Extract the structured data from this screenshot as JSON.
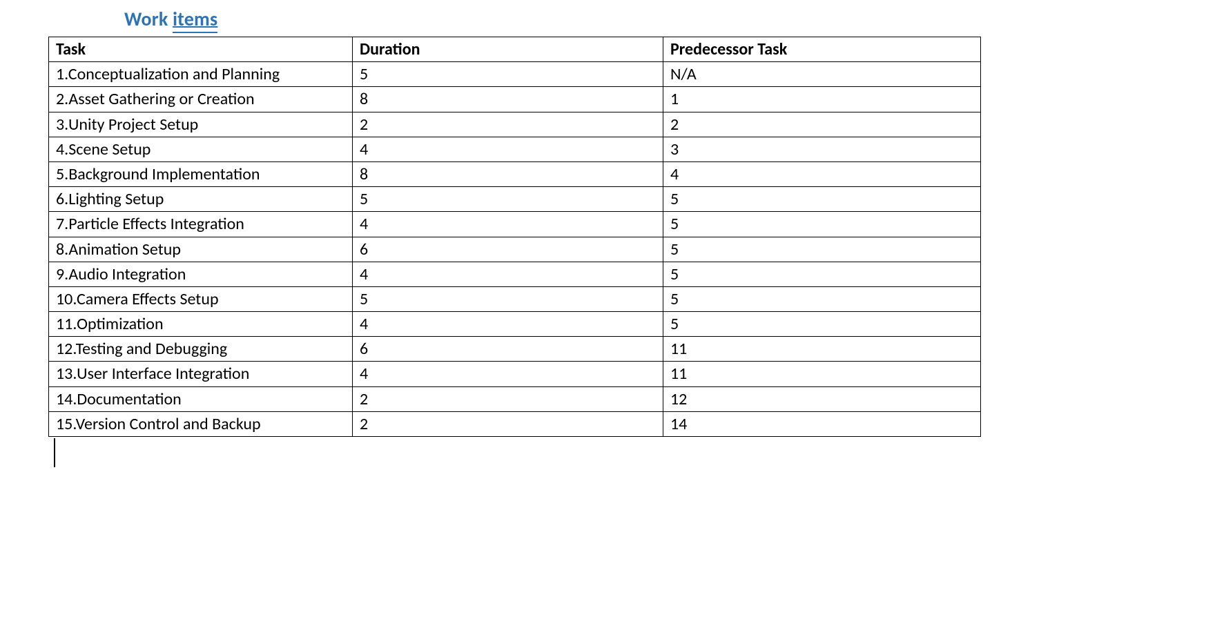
{
  "heading": {
    "word1": "Work",
    "word2": "items"
  },
  "table": {
    "headers": {
      "task": "Task",
      "duration": "Duration",
      "predecessor": "Predecessor Task"
    },
    "rows": [
      {
        "task": "1.Conceptualization and Planning",
        "duration": "5",
        "predecessor": "N/A"
      },
      {
        "task": "2.Asset Gathering or Creation",
        "duration": "8",
        "predecessor": "1"
      },
      {
        "task": "3.Unity Project Setup",
        "duration": "2",
        "predecessor": "2"
      },
      {
        "task": "4.Scene Setup",
        "duration": "4",
        "predecessor": "3"
      },
      {
        "task": "5.Background Implementation",
        "duration": "8",
        "predecessor": "4"
      },
      {
        "task": "6.Lighting Setup",
        "duration": "5",
        "predecessor": "5"
      },
      {
        "task": "7.Particle Effects Integration",
        "duration": "4",
        "predecessor": "5"
      },
      {
        "task": "8.Animation Setup",
        "duration": "6",
        "predecessor": "5"
      },
      {
        "task": "9.Audio Integration",
        "duration": "4",
        "predecessor": "5"
      },
      {
        "task": "10.Camera Effects Setup",
        "duration": "5",
        "predecessor": "5"
      },
      {
        "task": "11.Optimization",
        "duration": "4",
        "predecessor": "5"
      },
      {
        "task": "12.Testing and Debugging",
        "duration": "6",
        "predecessor": "11"
      },
      {
        "task": "13.User Interface Integration",
        "duration": "4",
        "predecessor": "11"
      },
      {
        "task": "14.Documentation",
        "duration": "2",
        "predecessor": "12"
      },
      {
        "task": "15.Version Control and Backup",
        "duration": "2",
        "predecessor": "14"
      }
    ]
  }
}
